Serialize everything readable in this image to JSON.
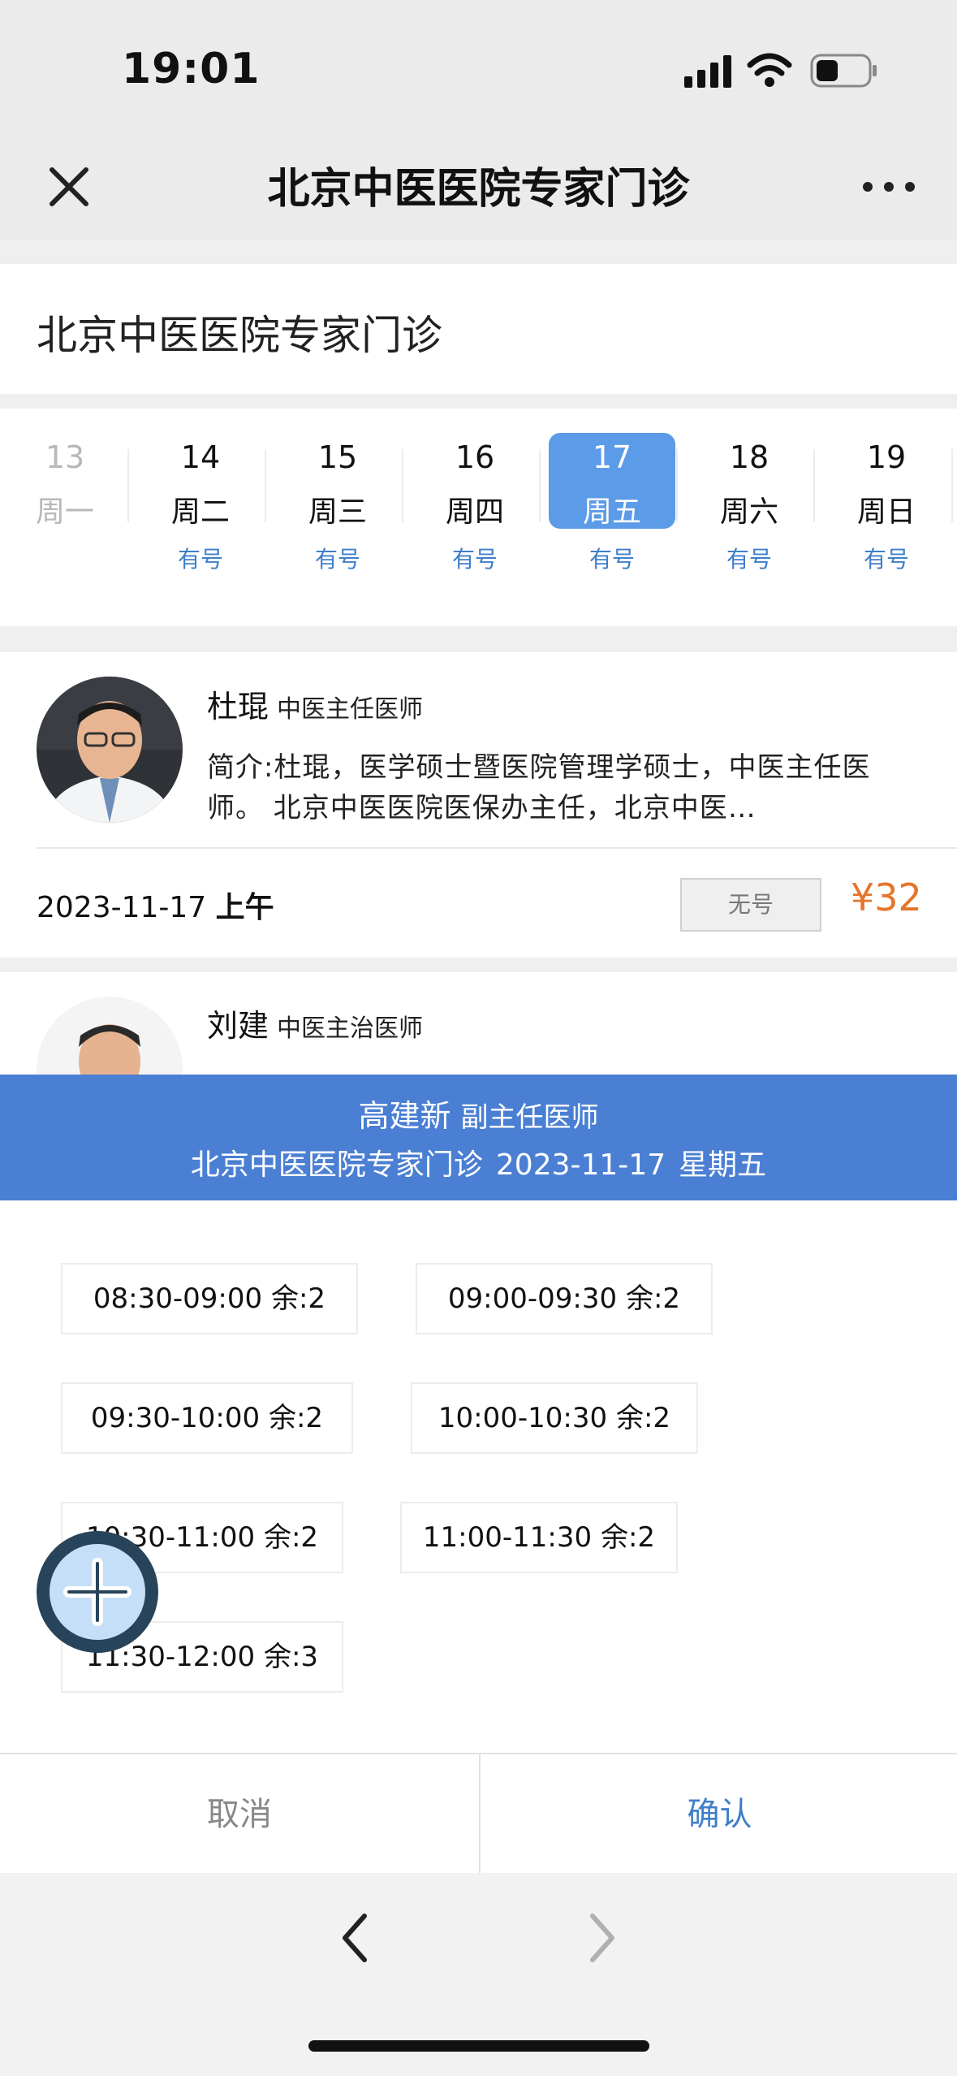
{
  "status_bar": {
    "time": "19:01"
  },
  "nav": {
    "title": "北京中医医院专家门诊"
  },
  "header": {
    "title": "北京中医医院专家门诊"
  },
  "dates": [
    {
      "num": "13",
      "weekday": "周一",
      "availability": "",
      "disabled": true,
      "selected": false
    },
    {
      "num": "14",
      "weekday": "周二",
      "availability": "有号",
      "disabled": false,
      "selected": false
    },
    {
      "num": "15",
      "weekday": "周三",
      "availability": "有号",
      "disabled": false,
      "selected": false
    },
    {
      "num": "16",
      "weekday": "周四",
      "availability": "有号",
      "disabled": false,
      "selected": false
    },
    {
      "num": "17",
      "weekday": "周五",
      "availability": "有号",
      "disabled": false,
      "selected": true
    },
    {
      "num": "18",
      "weekday": "周六",
      "availability": "有号",
      "disabled": false,
      "selected": false
    },
    {
      "num": "19",
      "weekday": "周日",
      "availability": "有号",
      "disabled": false,
      "selected": false
    }
  ],
  "doctors": [
    {
      "name": "杜琨",
      "title": "中医主任医师",
      "intro": "简介:杜琨，医学硕士暨医院管理学硕士，中医主任医师。 北京中医医院医保办主任，北京中医…",
      "schedule_date": "2023-11-17",
      "schedule_period": "上午",
      "status": "无号",
      "price": "¥32"
    },
    {
      "name": "刘建",
      "title": "中医主治医师"
    }
  ],
  "modal": {
    "doctor_name": "高建新",
    "doctor_title": "副主任医师",
    "clinic": "北京中医医院专家门诊",
    "date": "2023-11-17",
    "weekday": "星期五",
    "slots": [
      "08:30-09:00 余:2",
      "09:00-09:30 余:2",
      "09:30-10:00 余:2",
      "10:00-10:30 余:2",
      "10:30-11:00 余:2",
      "11:00-11:30 余:2",
      "11:30-12:00 余:3"
    ],
    "cancel_label": "取消",
    "confirm_label": "确认"
  },
  "colors": {
    "accent": "#5b9be8",
    "modal_header": "#4a7fd3",
    "price": "#e5752b",
    "availability": "#3f7fc9"
  }
}
